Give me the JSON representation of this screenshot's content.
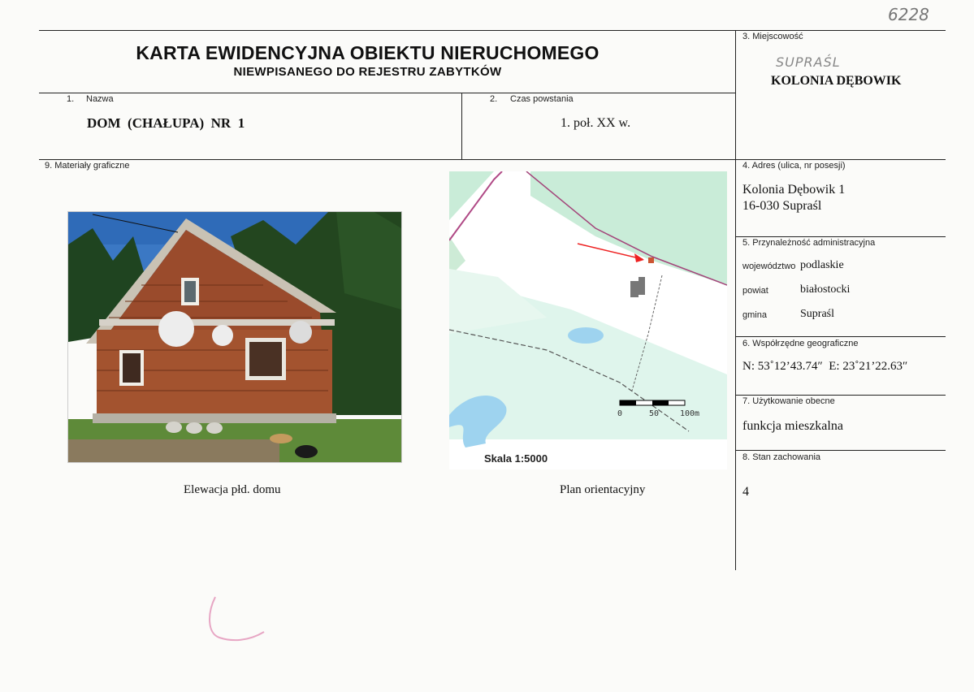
{
  "catalog_number": "6228",
  "header": {
    "title": "KARTA EWIDENCYJNA OBIEKTU NIERUCHOMEGO",
    "subtitle": "NIEWPISANEGO DO REJESTRU ZABYTKÓW"
  },
  "field_name": {
    "num": "1.",
    "label": "Nazwa",
    "value": "DOM  (CHAŁUPA)  NR  1"
  },
  "field_time": {
    "num": "2.",
    "label": "Czas powstania",
    "value": "1. poł. XX w."
  },
  "field_locality": {
    "label": "3. Miejscowość",
    "handwritten": "SUPRAŚL",
    "value": "KOLONIA DĘBOWIK"
  },
  "field_graphics": {
    "label": "9. Materiały graficzne"
  },
  "field_address": {
    "label": "4. Adres (ulica, nr posesji)",
    "line1": "Kolonia Dębowik 1",
    "line2": "16-030 Supraśl"
  },
  "field_admin": {
    "label": "5. Przynależność administracyjna",
    "wojewodztwo_label": "województwo",
    "wojewodztwo_value": "podlaskie",
    "powiat_label": "powiat",
    "powiat_value": "białostocki",
    "gmina_label": "gmina",
    "gmina_value": "Supraśl"
  },
  "field_coords": {
    "label": "6. Współrzędne geograficzne",
    "value": "N: 53˚12’43.74″  E: 23˚21’22.63″"
  },
  "field_usage": {
    "label": "7. Użytkowanie obecne",
    "value": "funkcja mieszkalna"
  },
  "field_condition": {
    "label": "8. Stan zachowania",
    "value": "4"
  },
  "photo": {
    "caption": "Elewacja płd. domu"
  },
  "map": {
    "caption": "Plan orientacyjny",
    "scale": "Skala 1:5000",
    "scale_ticks": [
      "0",
      "50",
      "100m"
    ]
  }
}
